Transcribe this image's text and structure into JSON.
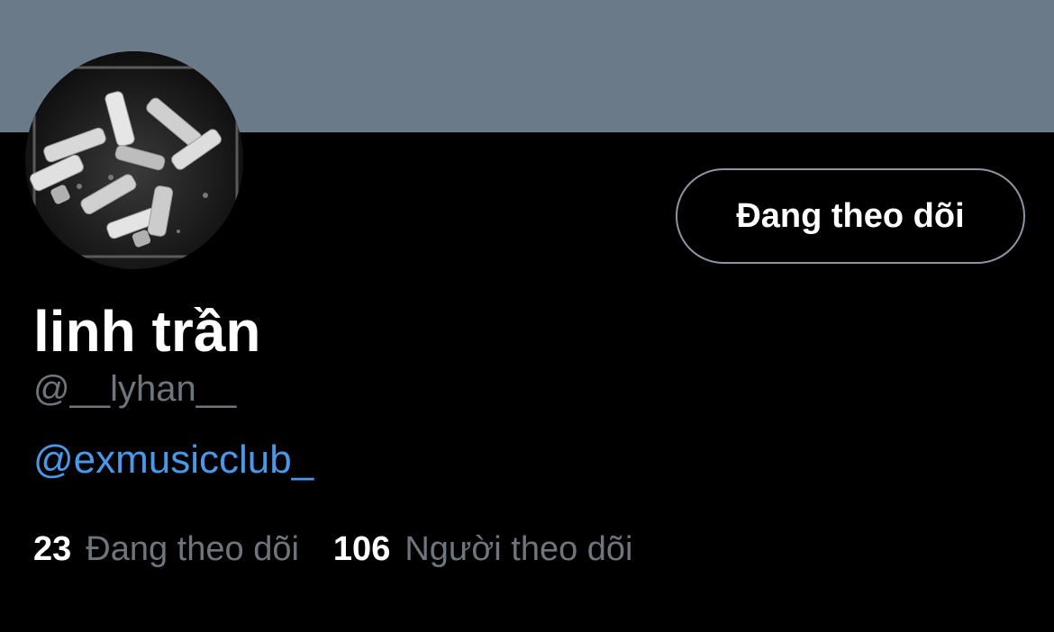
{
  "profile": {
    "display_name": "linh trần",
    "handle": "@__lyhan__",
    "bio_link": "@exmusicclub_",
    "follow_button_label": "Đang theo dõi",
    "stats": {
      "following_count": "23",
      "following_label": "Đang theo dõi",
      "followers_count": "106",
      "followers_label": "Người theo dõi"
    }
  },
  "colors": {
    "banner": "#6b7a88",
    "background": "#000000",
    "link": "#4a99e9",
    "muted_text": "#6e767d",
    "button_border": "#8a96a3"
  },
  "icons": {
    "avatar": "avatar-photo"
  }
}
